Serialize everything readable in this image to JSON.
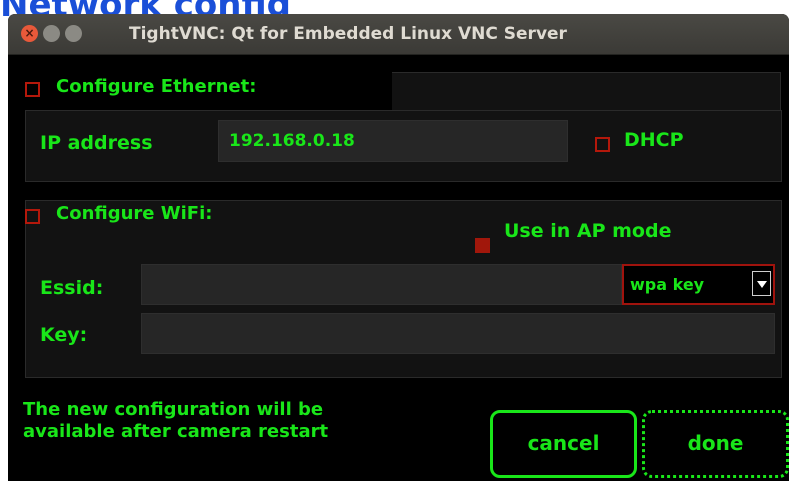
{
  "page": {
    "heading": "Network config"
  },
  "window": {
    "title": "TightVNC: Qt for Embedded Linux VNC Server",
    "controls": {
      "close": "×",
      "minimize": "–",
      "maximize": "□"
    }
  },
  "ethernet": {
    "section_label": "Configure Ethernet:",
    "enabled": false,
    "ip_label": "IP address",
    "ip_value": "192.168.0.18",
    "dhcp_label": "DHCP",
    "dhcp": false
  },
  "wifi": {
    "section_label": "Configure WiFi:",
    "enabled": false,
    "ap_mode_label": "Use in AP mode",
    "ap_mode": true,
    "essid_label": "Essid:",
    "essid_value": "",
    "key_label": "Key:",
    "key_value": "",
    "security_selected": "wpa key"
  },
  "footer": {
    "note_line1": "The new configuration will be",
    "note_line2": "available after camera restart",
    "cancel_label": "cancel",
    "done_label": "done"
  },
  "colors": {
    "accent_green": "#19e619",
    "checkbox_red": "#b4180b",
    "heading_blue": "#1a4fd8",
    "window_bg": "#000000"
  }
}
